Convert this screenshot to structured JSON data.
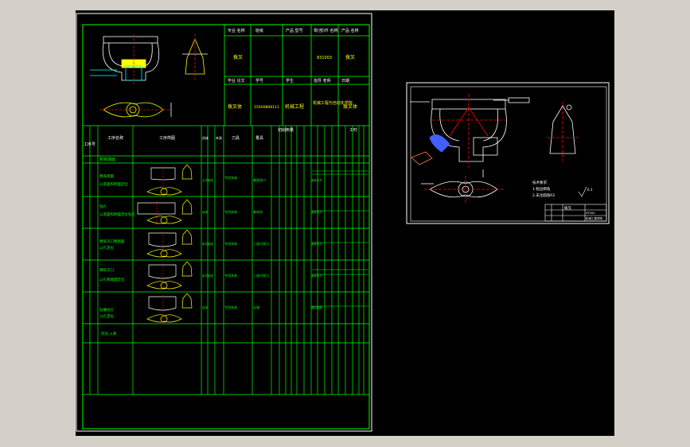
{
  "process_card": {
    "header_row1": [
      "专业 名称",
      "班级",
      "产品 型号",
      "零(部)件 名称",
      "产品 名称"
    ],
    "header_row1_values": [
      "拨叉",
      "831003",
      "拨叉"
    ],
    "header_row2": [
      "毕业 论文",
      "学号",
      "学生",
      "指导 老师",
      "日期"
    ],
    "header_row2_values": [
      "拨叉体",
      "150X0808111",
      "机械工程",
      "机械工程与自动化学院",
      "拨叉体"
    ],
    "col_headers": [
      "工序号",
      "工序名称",
      "工序简图",
      "机床",
      "夹具",
      "刀具",
      "量具",
      "切削用量",
      "工时"
    ],
    "operations": [
      {
        "name": "粗铣端面",
        "desc": "以底面和侧面定位",
        "machine": "立式铣床",
        "fixture": "专用夹具",
        "tool": "端面铣刀",
        "gauge": "游标卡尺"
      },
      {
        "name": "钻孔",
        "desc": "以底面和侧面定位钻孔",
        "machine": "钻床",
        "fixture": "专用夹具",
        "tool": "麻花钻",
        "gauge": "游标卡尺"
      },
      {
        "name": "粗铣叉口两侧面",
        "desc": "以孔定位",
        "machine": "卧式铣床",
        "fixture": "专用夹具",
        "tool": "三面刃铣刀",
        "gauge": "游标卡尺"
      },
      {
        "name": "精铣叉口",
        "desc": "以孔和端面定位",
        "machine": "卧式铣床",
        "fixture": "专用夹具",
        "tool": "三面刃铣刀",
        "gauge": "游标卡尺"
      },
      {
        "name": "钻螺纹孔",
        "desc": "以孔定位",
        "machine": "钻床",
        "fixture": "专用夹具",
        "tool": "丝锥",
        "gauge": "螺纹塞规"
      },
      {
        "name": "检验,入库",
        "desc": "",
        "machine": "",
        "fixture": "",
        "tool": "",
        "gauge": ""
      }
    ]
  },
  "part_drawing": {
    "tech_requirements": [
      "技术要求",
      "1.锐边倒角",
      "2.未注圆角R2"
    ],
    "roughness": "6.3",
    "title_block": {
      "name": "拨叉",
      "material": "HT200",
      "school": "机械工程学院"
    }
  },
  "colors": {
    "background": "#000000",
    "frame": "#ffffff",
    "border_green": "#00ff00",
    "text_yellow": "#ffff00",
    "lines_white": "#ffffff",
    "center_red": "#ff0000",
    "highlight_blue": "#4060ff",
    "dim_cyan": "#00ffff"
  }
}
